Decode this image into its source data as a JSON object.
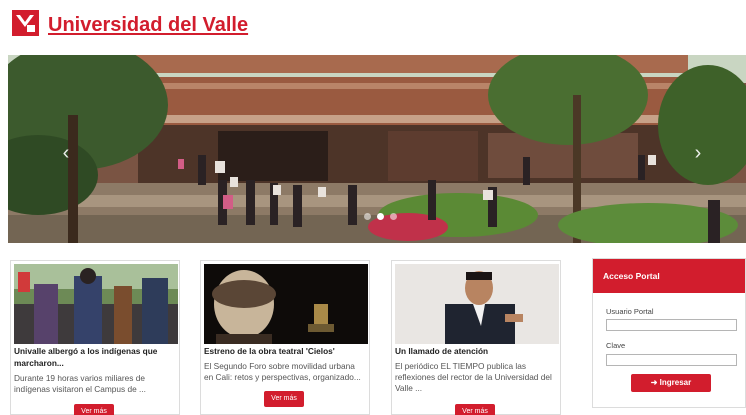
{
  "header": {
    "site_title": "Universidad del Valle"
  },
  "slider": {
    "prev_arrow": "‹",
    "next_arrow": "›",
    "slide_count": 3,
    "active_slide": 2
  },
  "cards": [
    {
      "title": "Univalle albergó a los indígenas que marcharon...",
      "text": "Durante 19 horas varios miliares de indígenas visitaron el Campus de ...",
      "button": "Ver más"
    },
    {
      "title": "Estreno de la obra teatral 'Cielos'",
      "text": "El Segundo Foro sobre movilidad urbana en Cali: retos y perspectivas, organizado...",
      "button": "Ver más"
    },
    {
      "title": "Un llamado de atención",
      "text": "El periódico EL TIEMPO publica las reflexiones del rector de la Universidad del Valle ...",
      "button": "Ver más"
    }
  ],
  "portal": {
    "title": "Acceso Portal",
    "user_label": "Usuario Portal",
    "user_value": "",
    "password_label": "Clave",
    "password_value": "",
    "login_button": "Ingresar"
  },
  "colors": {
    "brand_red": "#d21d2d"
  }
}
